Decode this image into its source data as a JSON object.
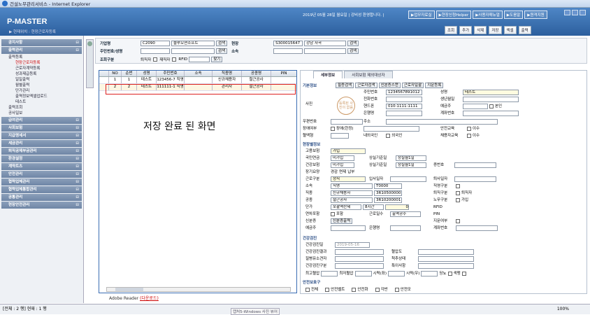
{
  "window": {
    "title": "건설노무관리서비스 - Internet Explorer"
  },
  "header": {
    "logo": "P-MASTER",
    "location": "▶ 현재위치 : 현장근로자등록",
    "info": "2019년 05월 28일 월요일 | 강비성 환영합니다. |",
    "top_buttons": [
      "▶업무자료실",
      "▶현장신청Helper",
      "▶사용자매뉴얼",
      "▶도움말",
      "▶원격지원"
    ],
    "toolbar": [
      "조회",
      "추가",
      "삭제",
      "저장",
      "엑셀",
      "출력"
    ]
  },
  "sidebar": {
    "sections": [
      {
        "label": "공지사항"
      },
      {
        "label": "출력관리",
        "items": [
          {
            "label": "출력등록",
            "type": "folder"
          },
          {
            "label": "현장근로자등록",
            "type": "sub",
            "active": true
          },
          {
            "label": "근로자계약등록",
            "type": "sub"
          },
          {
            "label": "성과제급등록",
            "type": "sub"
          },
          {
            "label": "일일출력",
            "type": "sub"
          },
          {
            "label": "월별출력",
            "type": "sub"
          },
          {
            "label": "단가관리",
            "type": "sub"
          },
          {
            "label": "출역정보엑셀업로드",
            "type": "sub"
          },
          {
            "label": "테스트",
            "type": "sub"
          },
          {
            "label": "출력조회",
            "type": "folder"
          },
          {
            "label": "공사일보",
            "type": "folder"
          }
        ]
      },
      {
        "label": "급여관리"
      },
      {
        "label": "사회보험"
      },
      {
        "label": "지급명세서"
      },
      {
        "label": "세금관리"
      },
      {
        "label": "퇴직공제부금관리"
      },
      {
        "label": "환경설정"
      },
      {
        "label": "계약트츠"
      },
      {
        "label": "안전관리"
      },
      {
        "label": "협력업체관리"
      },
      {
        "label": "협력업체통합관리"
      },
      {
        "label": "공통관리"
      },
      {
        "label": "현장안전관리"
      }
    ]
  },
  "filter": {
    "company_label": "기업명",
    "company_code": "C2090",
    "company_name": "블루오션소프트",
    "site_label": "현장",
    "site_code": "S300015647",
    "site_name": "강남 자곡",
    "rrn_label": "주민번호/성명",
    "affil_label": "소속",
    "cond_label": "조회구분",
    "cond_opts": [
      "퇴직자",
      "재직자",
      "RFID"
    ],
    "search": "검색",
    "find": "찾기"
  },
  "grid": {
    "headers": [
      "NO",
      "순번",
      "성명",
      "주민번호",
      "소속",
      "직종명",
      "공종명",
      "PIN"
    ],
    "rows": [
      [
        "1",
        "1",
        "테스트",
        "123456-7 직영",
        "",
        "신규채용자",
        "철근공사",
        ""
      ],
      [
        "2",
        "2",
        "테스트",
        "111111-1 직영",
        "",
        "관리자",
        "철근공사",
        ""
      ]
    ],
    "caption": "저장 완료 된 화면"
  },
  "panel": {
    "tabs": [
      "세부정보",
      "사회보험 제외대상자"
    ],
    "basic_title": "기본정보",
    "btns": [
      "필증검색",
      "근로자검색",
      "신분증스캔",
      "근로자일괄",
      "지문등록"
    ],
    "photo_label": "사진",
    "no_photo": "등록된 사진이 없음",
    "rrn_label": "주민번호",
    "rrn": "1234567891012",
    "name_label": "성명",
    "name": "테스트",
    "tel_label": "전화번호",
    "birth_label": "생년월일",
    "mobile_label": "핸드폰",
    "mobile": "010-1111-1111",
    "bank_label": "예금주",
    "self_label": "본인",
    "bankname_label": "은행명",
    "account_label": "계좌번호",
    "zip_label": "우편번호",
    "addr_label": "주소",
    "disabled_label": "장애여부",
    "disabled_opt": "장애(한정)",
    "safety_label": "안전교육",
    "safety_opt": "이수",
    "blood_label": "혈액형",
    "nation_opts": [
      "내외국인",
      "외국인"
    ],
    "hire_safety_label": "채용자교육",
    "hire_safety_opt": "이수",
    "site_title": "현장별정보",
    "emp_ins_label": "고용보험",
    "emp_ins": "가입",
    "pension_label": "국민연금",
    "pension": "미가입",
    "loss_label1": "상실기준일",
    "loss_val1": "상실월1일",
    "health_label": "건강보험",
    "health": "미가입",
    "loss_label2": "상실기준일",
    "loss_val2": "상실월1일",
    "cert_label": "증번호",
    "care_label": "장기요양",
    "care_opts": [
      "경감",
      "면제",
      "납부"
    ],
    "worktype_label": "근로구분",
    "worktype": "정직",
    "join_label": "입사일자",
    "retire_label": "퇴사일자",
    "affil_label": "소속",
    "affil": "직영",
    "affil_code": "T0000",
    "jobtype_label": "직영구분",
    "job_label": "직종",
    "job": "신규채용자",
    "job_code": "3R10500000",
    "retiretype_label": "퇴직구분",
    "retire_opt": "퇴직자",
    "trade_label": "공종",
    "trade": "철근공사",
    "trade_code": "3R10200001",
    "labor_label": "노무구분",
    "labor_opt": "가입",
    "price_label": "단가",
    "price_type": "포괄역산제",
    "hours": "8시간",
    "price_val": "0",
    "rfid_label": "RFID",
    "inc_label": "연차포함",
    "inc_opt": "포함",
    "workpay_label": "근로일수",
    "workpay": "출역공수",
    "pin_label": "PIN",
    "idcard_label": "신분증",
    "idcard_btn": "신분증출력",
    "finger_label": "지문여부",
    "bank2_label": "예금주",
    "bankname2_label": "은행명",
    "account2_label": "계좌번호",
    "check_title": "건강검진",
    "check_date_label": "건강검진일",
    "check_date": "2019-05-16",
    "check_result_label": "건강검진결과",
    "bp_label": "혈압도",
    "disease_label": "질병유소견자",
    "spine_label": "척추상태",
    "check_type_label": "건강검진구분",
    "special_label": "특이사항",
    "bp_max_label": "최고혈압",
    "bp_min_label": "최저혈압",
    "vision_l": "시력(좌)",
    "vision_r": "시력(우)",
    "diabetes": "당뇨",
    "colorblind": "색맹",
    "gear_title": "안전보호구",
    "gear": [
      "전체",
      "안전벨트",
      "안전화",
      "각반",
      "안전모"
    ]
  },
  "status": {
    "count": "[전체 : 2 행] 현재 : 1 행",
    "zoom": "100%",
    "taskbar": "캡처5-Windows 사진 뷰어"
  },
  "adobe": {
    "name": "Adobe Reader",
    "link": "(다운로드)"
  }
}
